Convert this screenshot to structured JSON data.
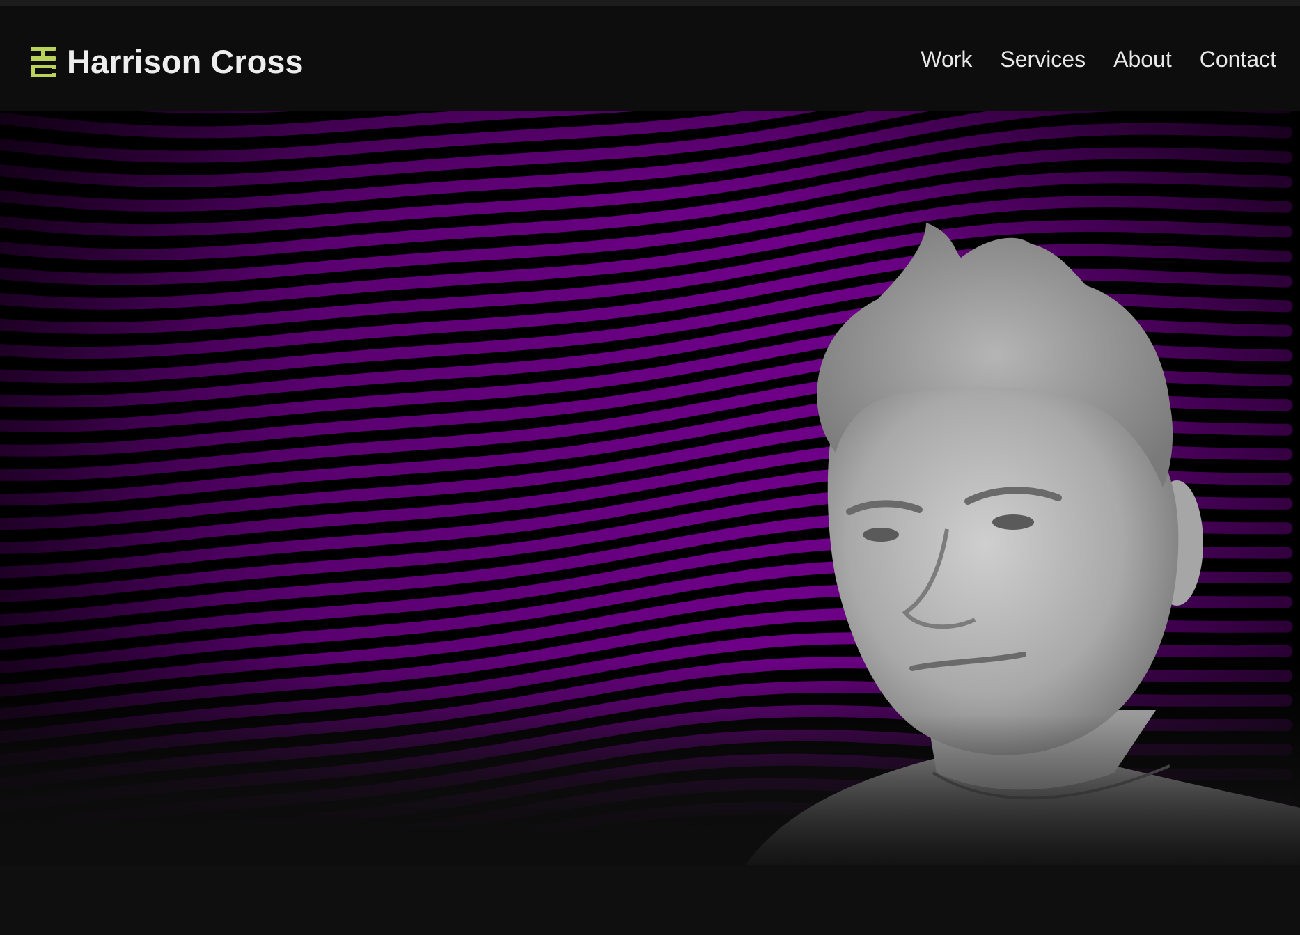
{
  "header": {
    "logo_monogram": "HC",
    "site_name": "Harrison Cross"
  },
  "nav": {
    "items": [
      {
        "label": "Work"
      },
      {
        "label": "Services"
      },
      {
        "label": "About"
      },
      {
        "label": "Contact"
      }
    ]
  },
  "hero": {
    "background": "purple-wave-lines",
    "portrait": "grayscale-man-portrait"
  },
  "colors": {
    "page_background": "#0d0d0d",
    "brand_accent": "#b9d35a",
    "wave_purple": "#6a0082",
    "nav_text": "#e8e8e8"
  }
}
